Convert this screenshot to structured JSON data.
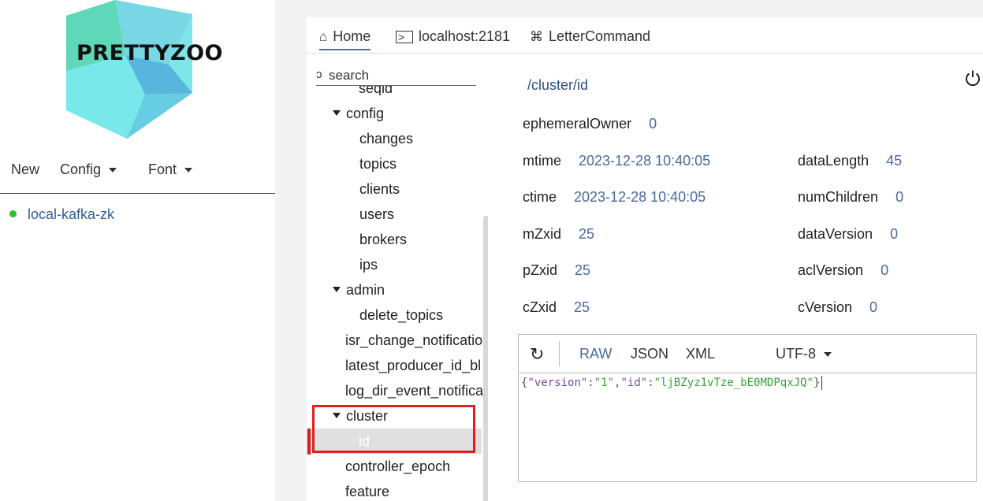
{
  "app": {
    "logo_text": "PRETTYZOO",
    "colors": {
      "accent": "#4a6a9c",
      "connected": "#2cc02c",
      "highlight": "#e02020"
    }
  },
  "sidebar": {
    "menu": [
      {
        "label": "New",
        "dropdown": false
      },
      {
        "label": "Config",
        "dropdown": true
      },
      {
        "label": "Font",
        "dropdown": true
      }
    ],
    "servers": [
      {
        "name": "local-kafka-zk",
        "status": "connected"
      }
    ]
  },
  "tabs": [
    {
      "label": "Home",
      "icon": "home-icon",
      "active": true
    },
    {
      "label": "localhost:2181",
      "icon": "terminal-icon",
      "active": false
    },
    {
      "label": "LetterCommand",
      "icon": "command-icon",
      "active": false
    }
  ],
  "tree": {
    "search_placeholder": "search",
    "nodes": [
      {
        "label": "seqid",
        "expanded": false
      },
      {
        "label": "config",
        "expanded": true
      },
      {
        "label": "changes"
      },
      {
        "label": "topics"
      },
      {
        "label": "clients"
      },
      {
        "label": "users"
      },
      {
        "label": "brokers"
      },
      {
        "label": "ips"
      },
      {
        "label": "admin",
        "expanded": true
      },
      {
        "label": "delete_topics"
      },
      {
        "label": "isr_change_notificatio"
      },
      {
        "label": "latest_producer_id_bl"
      },
      {
        "label": "log_dir_event_notifica"
      },
      {
        "label": "cluster",
        "expanded": true
      },
      {
        "label": "id",
        "selected": true
      },
      {
        "label": "controller_epoch"
      },
      {
        "label": "feature"
      }
    ]
  },
  "detail": {
    "path": "/cluster/id",
    "ephemeralOwner": {
      "label": "ephemeralOwner",
      "value": "0"
    },
    "left_fields": [
      {
        "label": "mtime",
        "value": "2023-12-28 10:40:05"
      },
      {
        "label": "ctime",
        "value": "2023-12-28 10:40:05"
      },
      {
        "label": "mZxid",
        "value": "25"
      },
      {
        "label": "pZxid",
        "value": "25"
      },
      {
        "label": "cZxid",
        "value": "25"
      }
    ],
    "right_fields": [
      {
        "label": "dataLength",
        "value": "45"
      },
      {
        "label": "numChildren",
        "value": "0"
      },
      {
        "label": "dataVersion",
        "value": "0"
      },
      {
        "label": "aclVersion",
        "value": "0"
      },
      {
        "label": "cVersion",
        "value": "0"
      }
    ]
  },
  "editor": {
    "formats": [
      "RAW",
      "JSON",
      "XML"
    ],
    "active_format": "RAW",
    "encoding": "UTF-8",
    "content": {
      "open": "{",
      "k1": "\"version\"",
      "colon": ":",
      "v1": "\"1\"",
      "comma": ",",
      "k2": "\"id\"",
      "v2": "\"ljBZyz1vTze_bE0MDPqxJQ\"",
      "close": "}"
    }
  }
}
